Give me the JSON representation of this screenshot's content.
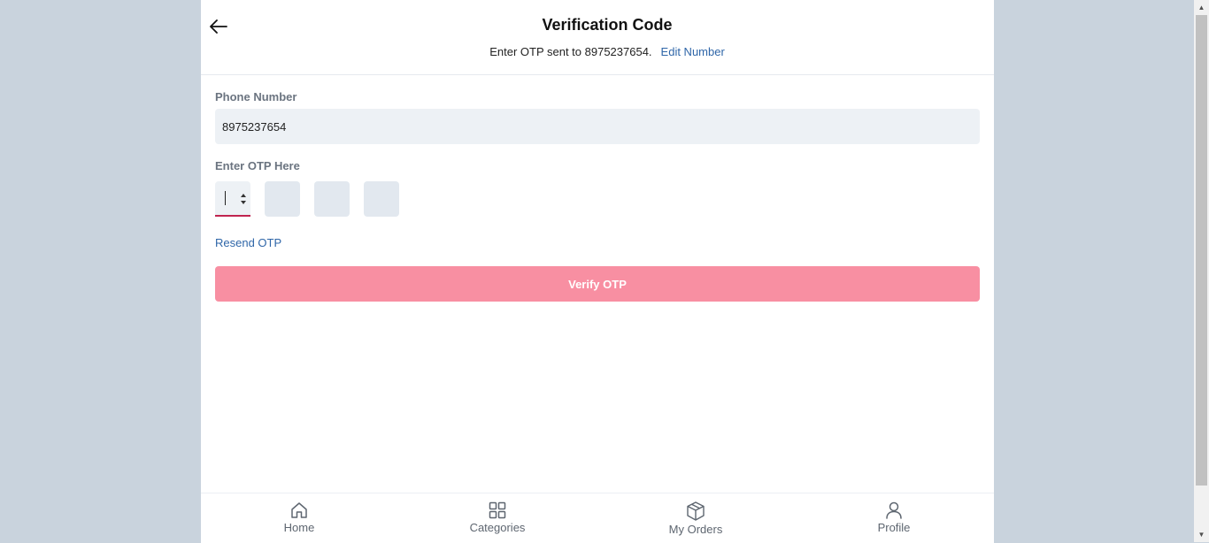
{
  "header": {
    "title": "Verification Code",
    "subtitle": "Enter OTP sent to 8975237654.",
    "edit_link": "Edit Number"
  },
  "form": {
    "phone_label": "Phone Number",
    "phone_value": "8975237654",
    "otp_label": "Enter OTP Here",
    "otp_digits": [
      "",
      "",
      "",
      ""
    ],
    "resend_label": "Resend OTP",
    "verify_label": "Verify OTP"
  },
  "bottom_nav": {
    "items": [
      {
        "label": "Home",
        "icon": "home-icon"
      },
      {
        "label": "Categories",
        "icon": "grid-icon"
      },
      {
        "label": "My Orders",
        "icon": "box-icon"
      },
      {
        "label": "Profile",
        "icon": "user-icon"
      }
    ]
  },
  "colors": {
    "background": "#c9d3dd",
    "accent_pink": "#f88fa2",
    "active_underline": "#c0244f",
    "link_blue": "#2f66a8",
    "field_bg": "#edf1f5"
  }
}
